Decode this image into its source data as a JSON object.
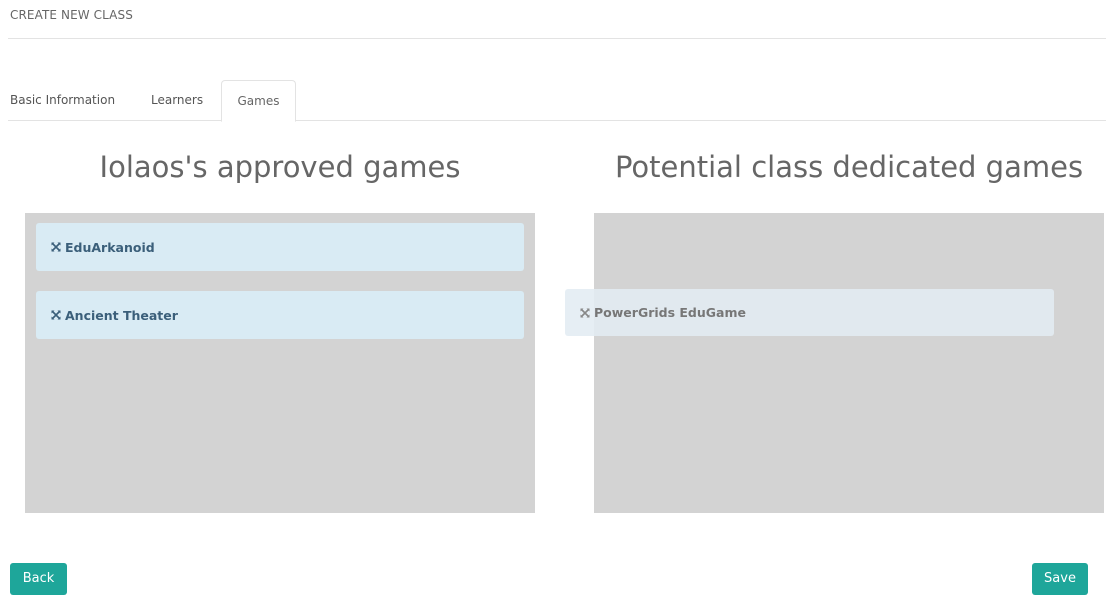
{
  "page": {
    "heading": "CREATE NEW CLASS"
  },
  "tabs": [
    {
      "label": "Basic Information",
      "active": false
    },
    {
      "label": "Learners",
      "active": false
    },
    {
      "label": "Games",
      "active": true
    }
  ],
  "panels": {
    "approved": {
      "title": "Iolaos's approved games",
      "games": [
        {
          "label": "EduArkanoid",
          "icon": "move-icon"
        },
        {
          "label": "Ancient Theater",
          "icon": "move-icon"
        }
      ]
    },
    "dedicated": {
      "title": "Potential class dedicated games",
      "games": []
    }
  },
  "dragging_item": {
    "label": "PowerGrids EduGame",
    "icon": "move-icon"
  },
  "actions": {
    "back_label": "Back",
    "save_label": "Save"
  },
  "colors": {
    "accent": "#1ea69a",
    "card_bg": "#d9ebf4",
    "card_text": "#3b5f7a",
    "dropzone_bg": "#d3d3d3"
  }
}
